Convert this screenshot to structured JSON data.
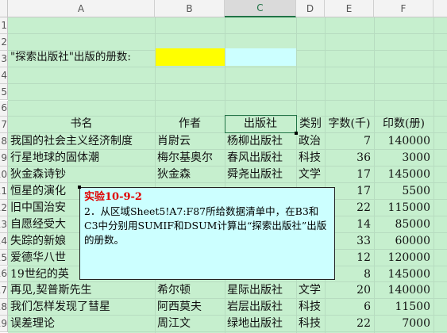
{
  "columns": [
    "A",
    "B",
    "C",
    "D",
    "E",
    "F"
  ],
  "selected_column": "C",
  "row_numbers": [
    "1",
    "2",
    "3",
    "4",
    "5",
    "6",
    "7",
    "8",
    "9",
    "10",
    "11",
    "12",
    "13",
    "14",
    "15",
    "16",
    "17",
    "18",
    "19"
  ],
  "label_row": {
    "text": "\"探索出版社\"出版的册数:"
  },
  "table_headers": {
    "book": "书名",
    "author": "作者",
    "publisher": "出版社",
    "category": "类别",
    "words": "字数(千)",
    "copies": "印数(册)"
  },
  "rows": [
    {
      "book": "我国的社会主义经济制度",
      "author": "肖尉云",
      "publisher": "杨柳出版社",
      "category": "政治",
      "words": "7",
      "copies": "140000"
    },
    {
      "book": "行星地球的固体潮",
      "author": "梅尔基奥尔",
      "publisher": "春风出版社",
      "category": "科技",
      "words": "36",
      "copies": "3000"
    },
    {
      "book": "狄金森诗钞",
      "author": "狄金森",
      "publisher": "舜尧出版社",
      "category": "文学",
      "words": "17",
      "copies": "145000"
    },
    {
      "book": "恒星的演化",
      "author": "",
      "publisher": "",
      "category": "",
      "words": "17",
      "copies": "5500"
    },
    {
      "book": "旧中国治安",
      "author": "",
      "publisher": "",
      "category": "",
      "words": "22",
      "copies": "115000"
    },
    {
      "book": "自愿经受大",
      "author": "",
      "publisher": "",
      "category": "",
      "words": "14",
      "copies": "85000"
    },
    {
      "book": "失踪的新娘",
      "author": "",
      "publisher": "",
      "category": "",
      "words": "33",
      "copies": "60000"
    },
    {
      "book": "爱德华八世",
      "author": "",
      "publisher": "",
      "category": "",
      "words": "12",
      "copies": "120000"
    },
    {
      "book": "19世纪的英",
      "author": "",
      "publisher": "",
      "category": "",
      "words": "8",
      "copies": "145000"
    },
    {
      "book": "再见,契普斯先生",
      "author": "希尔顿",
      "publisher": "星际出版社",
      "category": "文学",
      "words": "20",
      "copies": "140000"
    },
    {
      "book": "我们怎样发现了彗星",
      "author": "阿西莫夫",
      "publisher": "岩层出版社",
      "category": "科技",
      "words": "6",
      "copies": "11500"
    },
    {
      "book": "误差理论",
      "author": "周江文",
      "publisher": "绿地出版社",
      "category": "科技",
      "words": "22",
      "copies": "7000"
    }
  ],
  "comment": {
    "title": "实验10-9-2",
    "body": "2．从区域Sheet5!A7:F87所给数据清单中，在B3和C3中分别用SUMIF和DSUM计算出“探索出版社”出版的册数。"
  },
  "colors": {
    "grid_fill": "#c6efce",
    "highlight_b3": "#ffff00",
    "highlight_c3": "#ccffff",
    "comment_title": "#e00000"
  }
}
